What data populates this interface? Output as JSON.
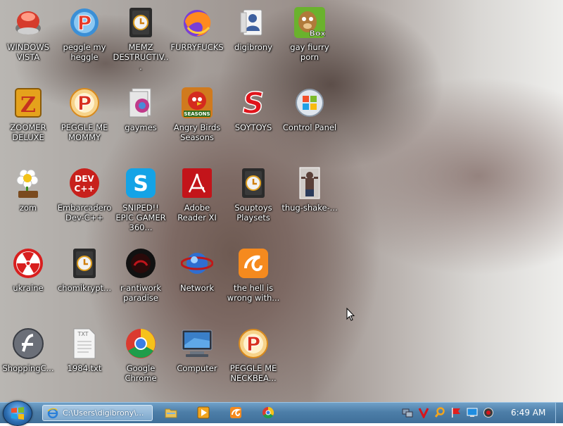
{
  "desktop": {
    "icons": [
      {
        "label": "WINDOWS VISTA",
        "icon": "vista-orb-icon"
      },
      {
        "label": "peggle my heggle",
        "icon": "peggle-icon"
      },
      {
        "label": "MEMZ DESTRUCTIV...",
        "icon": "shortcut-app-icon"
      },
      {
        "label": "FURRYFUCKS",
        "icon": "firefox-icon"
      },
      {
        "label": "digibrony",
        "icon": "user-folder-icon"
      },
      {
        "label": "gay fiurry porn",
        "icon": "box-game-icon"
      },
      {
        "label": "ZOOMER DELUXE",
        "icon": "zuma-icon"
      },
      {
        "label": "PEGGLE ME MOMMY",
        "icon": "peggle-icon"
      },
      {
        "label": "gaymes",
        "icon": "games-folder-icon"
      },
      {
        "label": "Angry Birds Seasons",
        "icon": "angry-birds-icon"
      },
      {
        "label": "SOYTOYS",
        "icon": "red-s-icon"
      },
      {
        "label": "Control Panel",
        "icon": "control-panel-icon"
      },
      {
        "label": "zom",
        "icon": "plants-icon"
      },
      {
        "label": "Embarcadero Dev-C++",
        "icon": "devcpp-icon"
      },
      {
        "label": "SNIPED!! EPIC GAMER 360...",
        "icon": "skype-icon"
      },
      {
        "label": "Adobe Reader XI",
        "icon": "adobe-reader-icon"
      },
      {
        "label": "Souptoys Playsets",
        "icon": "shortcut-app-icon"
      },
      {
        "label": "thug-shake-...",
        "icon": "photo-thumbnail-icon"
      },
      {
        "label": "ukraine",
        "icon": "radiation-icon"
      },
      {
        "label": "chomikrypt...",
        "icon": "shortcut-app-icon"
      },
      {
        "label": "r-antiwork paradise",
        "icon": "dark-circle-icon"
      },
      {
        "label": "Network",
        "icon": "network-icon"
      },
      {
        "label": "the hell is wrong with...",
        "icon": "uc-browser-icon"
      },
      {
        "label": "ShoppingC...",
        "icon": "flash-icon"
      },
      {
        "label": "1984.txt",
        "icon": "text-file-icon"
      },
      {
        "label": "Google Chrome",
        "icon": "chrome-icon"
      },
      {
        "label": "Computer",
        "icon": "computer-icon"
      },
      {
        "label": "PEGGLE ME NECKBEA...",
        "icon": "peggle-icon"
      }
    ]
  },
  "taskbar": {
    "active_window": {
      "label": "C:\\Users\\digibrony\\...",
      "icon": "ie-icon"
    },
    "pinned": [
      "folder-icon",
      "media-player-icon",
      "uc-browser-icon",
      "chrome-icon"
    ],
    "tray": [
      "network-tray-icon",
      "red-v-icon",
      "search-tray-icon",
      "flag-icon",
      "display-icon",
      "volume-icon"
    ],
    "clock": "6:49 AM"
  }
}
